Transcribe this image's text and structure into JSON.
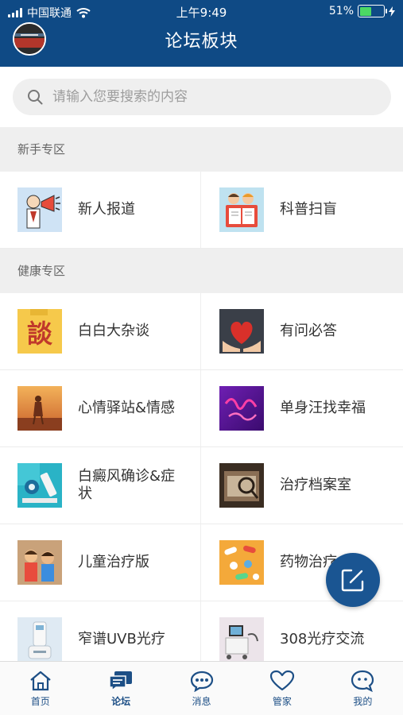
{
  "status_bar": {
    "carrier": "中国联通",
    "time": "上午9:49",
    "battery": "51%",
    "battery_level": 0.51
  },
  "header": {
    "title": "论坛板块"
  },
  "search": {
    "placeholder": "请输入您要搜索的内容"
  },
  "sections": [
    {
      "title": "新手专区",
      "rows": [
        [
          {
            "label": "新人报道",
            "icon": "megaphone-thumb"
          },
          {
            "label": "科普扫盲",
            "icon": "book-kids-thumb"
          }
        ]
      ]
    },
    {
      "title": "健康专区",
      "rows": [
        [
          {
            "label": "白白大杂谈",
            "icon": "talk-sticker-thumb"
          },
          {
            "label": "有问必答",
            "icon": "heart-hands-thumb"
          }
        ],
        [
          {
            "label": "心情驿站&情感",
            "icon": "sunset-girl-thumb"
          },
          {
            "label": "单身汪找幸福",
            "icon": "purple-script-thumb"
          }
        ],
        [
          {
            "label": "白癜风确诊&症状",
            "icon": "microscope-thumb"
          },
          {
            "label": "治疗档案室",
            "icon": "archive-thumb"
          }
        ],
        [
          {
            "label": "儿童治疗版",
            "icon": "children-thumb"
          },
          {
            "label": "药物治疗",
            "icon": "pills-thumb"
          }
        ],
        [
          {
            "label": "窄谱UVB光疗",
            "icon": "uvb-device-thumb"
          },
          {
            "label": "308光疗交流",
            "icon": "laser-device-thumb"
          }
        ]
      ]
    }
  ],
  "tabs": [
    {
      "label": "首页",
      "icon": "home-icon"
    },
    {
      "label": "论坛",
      "icon": "forum-icon"
    },
    {
      "label": "消息",
      "icon": "message-icon"
    },
    {
      "label": "管家",
      "icon": "heart-icon"
    },
    {
      "label": "我的",
      "icon": "profile-icon"
    }
  ],
  "colors": {
    "header": "#0f4a85",
    "accent": "#1d4f86",
    "fab": "#1a5592",
    "section_bg": "#efefef"
  }
}
